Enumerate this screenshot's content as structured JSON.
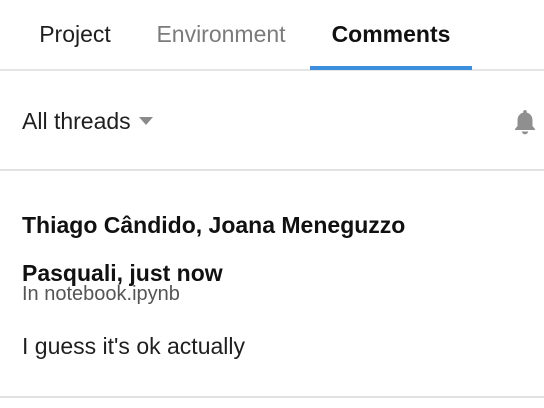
{
  "tabs": [
    {
      "label": "Project",
      "active": false
    },
    {
      "label": "Environment",
      "active": false
    },
    {
      "label": "Comments",
      "active": true
    }
  ],
  "accent_color": "#3b8fdc",
  "filter": {
    "label": "All threads",
    "icon": "caret-down-icon"
  },
  "notifications": {
    "icon": "bell-icon"
  },
  "comments": [
    {
      "authors_time": "Thiago Cândido, Joana Meneguzzo Pasquali, just now",
      "location": "In notebook.ipynb",
      "body": "I guess it's ok actually"
    }
  ]
}
